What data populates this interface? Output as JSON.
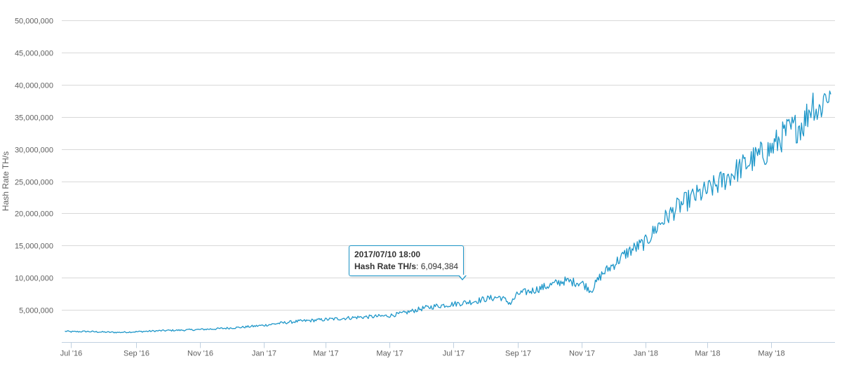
{
  "chart_data": {
    "type": "line",
    "ylabel": "Hash Rate TH/s",
    "ylim": [
      0,
      50000000
    ],
    "yticks": [
      {
        "value": 5000000,
        "label": "5,000,000"
      },
      {
        "value": 10000000,
        "label": "10,000,000"
      },
      {
        "value": 15000000,
        "label": "15,000,000"
      },
      {
        "value": 20000000,
        "label": "20,000,000"
      },
      {
        "value": 25000000,
        "label": "25,000,000"
      },
      {
        "value": 30000000,
        "label": "30,000,000"
      },
      {
        "value": 35000000,
        "label": "35,000,000"
      },
      {
        "value": 40000000,
        "label": "40,000,000"
      },
      {
        "value": 45000000,
        "label": "45,000,000"
      },
      {
        "value": 50000000,
        "label": "50,000,000"
      }
    ],
    "xlim": [
      "2016-06-22",
      "2018-07-01"
    ],
    "xticks": [
      {
        "date": "2016-07-01",
        "label": "Jul '16"
      },
      {
        "date": "2016-09-01",
        "label": "Sep '16"
      },
      {
        "date": "2016-11-01",
        "label": "Nov '16"
      },
      {
        "date": "2017-01-01",
        "label": "Jan '17"
      },
      {
        "date": "2017-03-01",
        "label": "Mar '17"
      },
      {
        "date": "2017-05-01",
        "label": "May '17"
      },
      {
        "date": "2017-07-01",
        "label": "Jul '17"
      },
      {
        "date": "2017-09-01",
        "label": "Sep '17"
      },
      {
        "date": "2017-11-01",
        "label": "Nov '17"
      },
      {
        "date": "2018-01-01",
        "label": "Jan '18"
      },
      {
        "date": "2018-03-01",
        "label": "Mar '18"
      },
      {
        "date": "2018-05-01",
        "label": "May '18"
      }
    ],
    "grid": true,
    "legend": "none",
    "line_color": "#1f97c9",
    "tooltip": {
      "date_label": "2017/07/10 18:00",
      "series_name": "Hash Rate TH/s",
      "value_label": "6,094,384",
      "x": "2017-07-10",
      "y": 6094384
    },
    "series": [
      {
        "values": [
          [
            "2016-06-25",
            1700000
          ],
          [
            "2016-07-01",
            1600000
          ],
          [
            "2016-07-15",
            1650000
          ],
          [
            "2016-08-01",
            1550000
          ],
          [
            "2016-08-15",
            1500000
          ],
          [
            "2016-09-01",
            1600000
          ],
          [
            "2016-09-15",
            1700000
          ],
          [
            "2016-10-01",
            1800000
          ],
          [
            "2016-10-15",
            1850000
          ],
          [
            "2016-11-01",
            1950000
          ],
          [
            "2016-11-15",
            2050000
          ],
          [
            "2016-12-01",
            2200000
          ],
          [
            "2016-12-15",
            2350000
          ],
          [
            "2017-01-01",
            2600000
          ],
          [
            "2017-01-15",
            2900000
          ],
          [
            "2017-02-01",
            3200000
          ],
          [
            "2017-02-15",
            3350000
          ],
          [
            "2017-03-01",
            3500000
          ],
          [
            "2017-03-15",
            3650000
          ],
          [
            "2017-04-01",
            3850000
          ],
          [
            "2017-04-15",
            3950000
          ],
          [
            "2017-05-01",
            4100000
          ],
          [
            "2017-05-15",
            4500000
          ],
          [
            "2017-06-01",
            5200000
          ],
          [
            "2017-06-15",
            5600000
          ],
          [
            "2017-07-01",
            5900000
          ],
          [
            "2017-07-10",
            6094384
          ],
          [
            "2017-07-20",
            6300000
          ],
          [
            "2017-08-01",
            6700000
          ],
          [
            "2017-08-15",
            7000000
          ],
          [
            "2017-08-25",
            6000000
          ],
          [
            "2017-09-01",
            7500000
          ],
          [
            "2017-09-15",
            8000000
          ],
          [
            "2017-10-01",
            8800000
          ],
          [
            "2017-10-15",
            9500000
          ],
          [
            "2017-11-01",
            9200000
          ],
          [
            "2017-11-10",
            8000000
          ],
          [
            "2017-11-20",
            10500000
          ],
          [
            "2017-12-01",
            12000000
          ],
          [
            "2017-12-15",
            14000000
          ],
          [
            "2018-01-01",
            15500000
          ],
          [
            "2018-01-15",
            18500000
          ],
          [
            "2018-02-01",
            21000000
          ],
          [
            "2018-02-15",
            22500000
          ],
          [
            "2018-03-01",
            23500000
          ],
          [
            "2018-03-15",
            25000000
          ],
          [
            "2018-04-01",
            27000000
          ],
          [
            "2018-04-15",
            28500000
          ],
          [
            "2018-05-01",
            30000000
          ],
          [
            "2018-05-15",
            32500000
          ],
          [
            "2018-06-01",
            34000000
          ],
          [
            "2018-06-10",
            37500000
          ],
          [
            "2018-06-15",
            35500000
          ],
          [
            "2018-06-22",
            38500000
          ],
          [
            "2018-06-27",
            38500000
          ]
        ]
      }
    ]
  }
}
